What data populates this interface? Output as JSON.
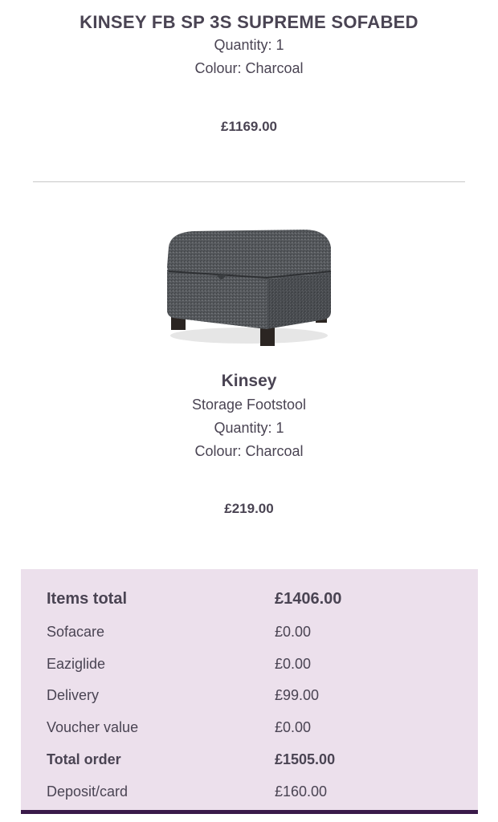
{
  "products": [
    {
      "title": "KINSEY FB SP 3S SUPREME SOFABED",
      "quantity": "Quantity: 1",
      "colour": "Colour: Charcoal",
      "price": "£1169.00"
    },
    {
      "name": "Kinsey",
      "subtitle": "Storage Footstool",
      "quantity": "Quantity: 1",
      "colour": "Colour: Charcoal",
      "price": "£219.00",
      "image": "charcoal-storage-footstool"
    }
  ],
  "summary": {
    "rows": [
      {
        "label": "Items total",
        "value": "£1406.00"
      },
      {
        "label": "Sofacare",
        "value": "£0.00"
      },
      {
        "label": "Eaziglide",
        "value": "£0.00"
      },
      {
        "label": "Delivery",
        "value": "£99.00"
      },
      {
        "label": "Voucher value",
        "value": "£0.00"
      },
      {
        "label": "Total order",
        "value": "£1505.00"
      },
      {
        "label": "Deposit/card",
        "value": "£160.00"
      }
    ]
  },
  "colors": {
    "text": "#4a4453",
    "summary_bg": "#ece0ec",
    "summary_border": "#3a1a4a",
    "divider": "#c8c8c8"
  }
}
